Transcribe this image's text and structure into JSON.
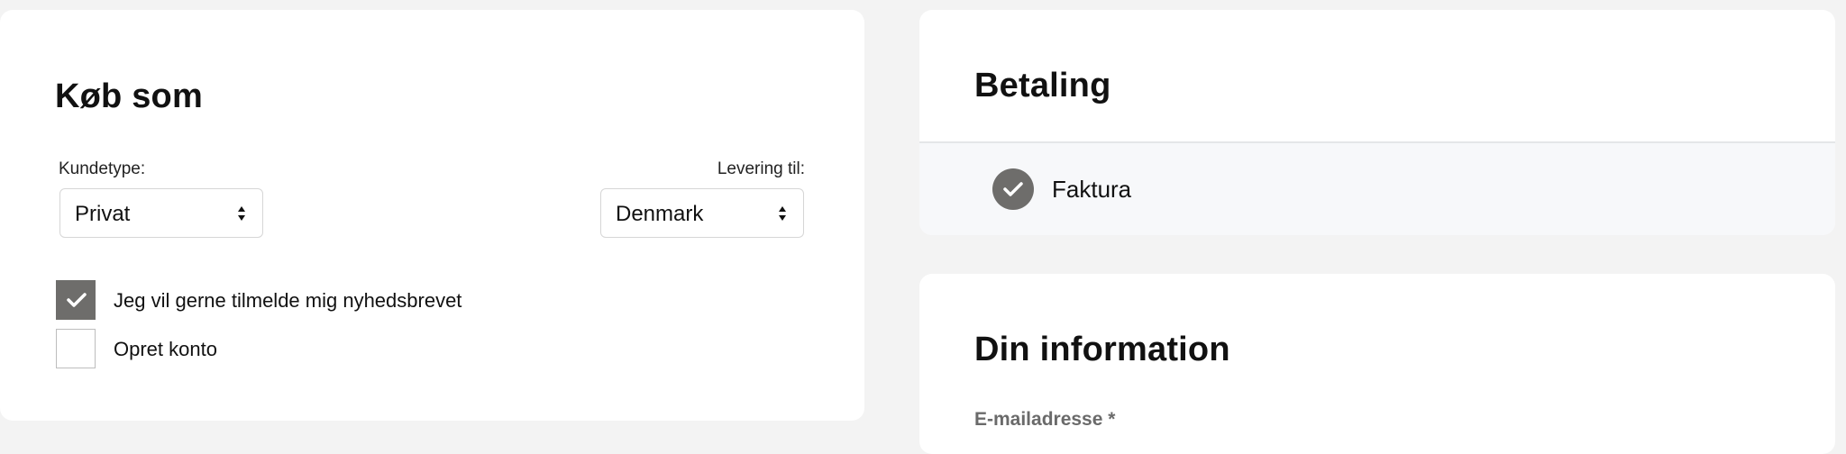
{
  "koeb_som": {
    "title": "Køb som",
    "kundetype": {
      "label": "Kundetype:",
      "value": "Privat"
    },
    "levering": {
      "label": "Levering til:",
      "value": "Denmark"
    },
    "newsletter": {
      "label": "Jeg vil gerne tilmelde mig nyhedsbrevet",
      "checked": true
    },
    "create_account": {
      "label": "Opret konto",
      "checked": false
    }
  },
  "betaling": {
    "title": "Betaling",
    "method": {
      "label": "Faktura",
      "selected": true,
      "icon": "check-circle-icon"
    }
  },
  "din_information": {
    "title": "Din information",
    "email_label": "E-mailadresse *"
  },
  "colors": {
    "background": "#f3f3f3",
    "card": "#ffffff",
    "checked_fill": "#6e6d6b",
    "selected_row": "#f7f8fa"
  }
}
